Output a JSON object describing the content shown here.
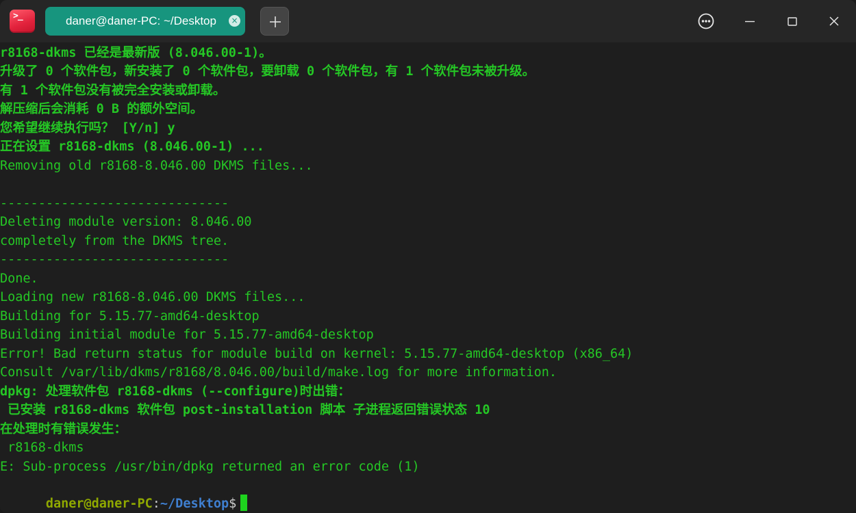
{
  "window": {
    "app_icon_glyph": ">_",
    "tab": {
      "title": "daner@daner-PC: ~/Desktop",
      "close_glyph": "×"
    },
    "colors": {
      "tab_active": "#17957e",
      "terminal_text": "#25c725",
      "prompt_user": "#8fa800",
      "prompt_path": "#3f7fd0",
      "cursor": "#1ed31e",
      "app_icon": "#e2223c"
    }
  },
  "controls": {
    "more_icon": "ellipsis-circle-icon",
    "minimize_icon": "minimize-icon",
    "maximize_icon": "maximize-icon",
    "close_icon": "close-icon"
  },
  "terminal": {
    "lines": [
      "r8168-dkms 已经是最新版 (8.046.00-1)。",
      "升级了 0 个软件包，新安装了 0 个软件包，要卸载 0 个软件包，有 1 个软件包未被升级。",
      "有 1 个软件包没有被完全安装或卸载。",
      "解压缩后会消耗 0 B 的额外空间。",
      "您希望继续执行吗？ [Y/n] y",
      "正在设置 r8168-dkms (8.046.00-1) ...",
      "Removing old r8168-8.046.00 DKMS files...",
      "",
      "------------------------------",
      "Deleting module version: 8.046.00",
      "completely from the DKMS tree.",
      "------------------------------",
      "Done.",
      "Loading new r8168-8.046.00 DKMS files...",
      "Building for 5.15.77-amd64-desktop",
      "Building initial module for 5.15.77-amd64-desktop",
      "Error! Bad return status for module build on kernel: 5.15.77-amd64-desktop (x86_64)",
      "Consult /var/lib/dkms/r8168/8.046.00/build/make.log for more information.",
      "dpkg: 处理软件包 r8168-dkms (--configure)时出错：",
      " 已安装 r8168-dkms 软件包 post-installation 脚本 子进程返回错误状态 10",
      "在处理时有错误发生：",
      " r8168-dkms",
      "E: Sub-process /usr/bin/dpkg returned an error code (1)"
    ],
    "prompt": {
      "user_host": "daner@daner-PC",
      "colon": ":",
      "path": "~/Desktop",
      "symbol": "$"
    }
  }
}
